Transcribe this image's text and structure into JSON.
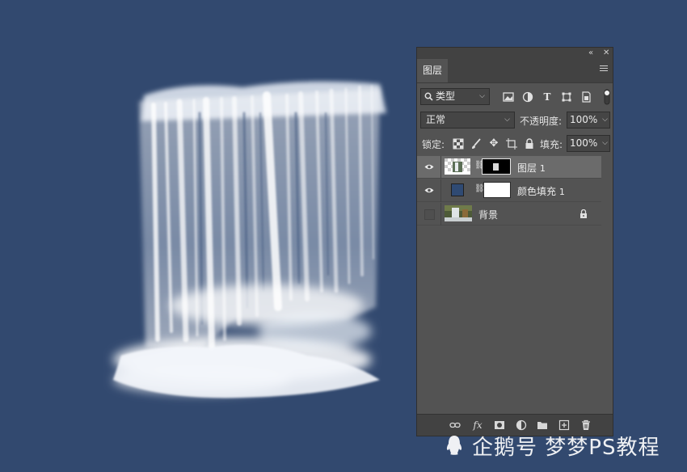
{
  "panel": {
    "tab_label": "图层",
    "filter": {
      "value": "类型"
    },
    "blend_mode": {
      "value": "正常"
    },
    "opacity": {
      "label": "不透明度:",
      "value": "100%"
    },
    "lock": {
      "label": "锁定:"
    },
    "fill": {
      "label": "填充:",
      "value": "100%"
    },
    "layers": [
      {
        "name": "图层",
        "num": "1",
        "visible": true,
        "selected": true
      },
      {
        "name": "颜色填充",
        "num": "1",
        "visible": true,
        "selected": false,
        "color": "#2f4a73"
      },
      {
        "name": "背景",
        "visible": false,
        "locked": true
      }
    ],
    "bottom_fx_label": "fx"
  },
  "watermark": {
    "text": "企鹅号 梦梦PS教程"
  },
  "colors": {
    "canvas_bg": "#32496f",
    "panel_bg": "#535353",
    "selected_row": "#6b6b6b"
  }
}
